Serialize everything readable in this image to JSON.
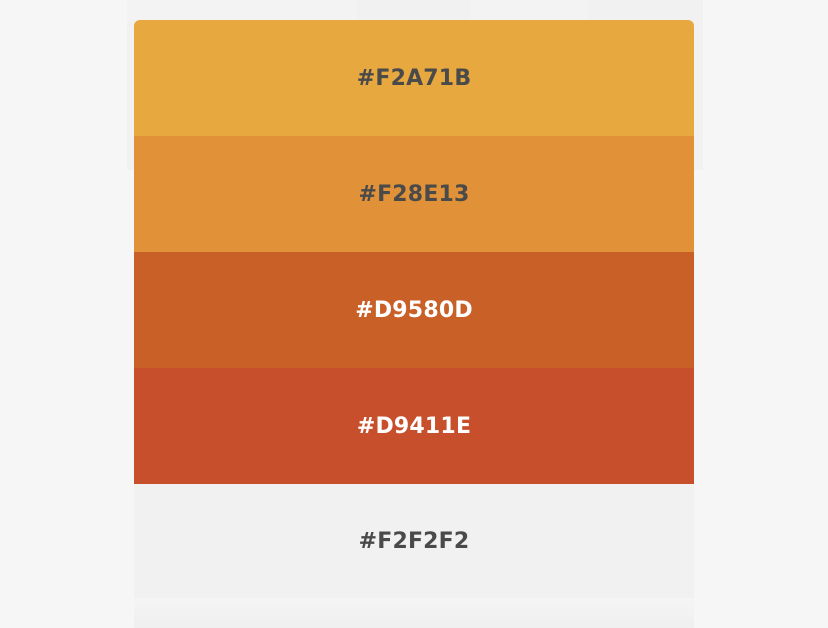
{
  "palette": {
    "swatches": [
      {
        "hex": "#F2A71B",
        "color": "#E6A83F",
        "text_color": "#4A4A4A"
      },
      {
        "hex": "#F28E13",
        "color": "#E19137",
        "text_color": "#4A4A4A"
      },
      {
        "hex": "#D9580D",
        "color": "#C86027",
        "text_color": "#FFFFFF"
      },
      {
        "hex": "#D9411E",
        "color": "#C84F2C",
        "text_color": "#FFFFFF"
      },
      {
        "hex": "#F2F2F2",
        "color": "#F1F1F1",
        "text_color": "#4A4A4A"
      }
    ]
  }
}
